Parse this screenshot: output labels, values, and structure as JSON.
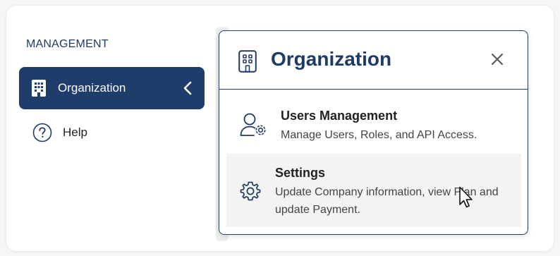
{
  "sidebar": {
    "section_title": "MANAGEMENT",
    "items": [
      {
        "label": "Organization",
        "icon": "building-icon",
        "active": true
      },
      {
        "label": "Help",
        "icon": "help-circle-icon",
        "active": false
      }
    ]
  },
  "flyout": {
    "title": "Organization",
    "title_icon": "building-outline-icon",
    "items": [
      {
        "title": "Users Management",
        "description": "Manage Users, Roles, and API Access.",
        "icon": "user-gear-icon"
      },
      {
        "title": "Settings",
        "description": "Update Company information, view Plan and update Payment.",
        "icon": "gear-icon",
        "hovered": true
      }
    ]
  },
  "colors": {
    "accent": "#1f3d6b",
    "heading": "#1e3a66",
    "hover_bg": "#f3f3f3"
  }
}
